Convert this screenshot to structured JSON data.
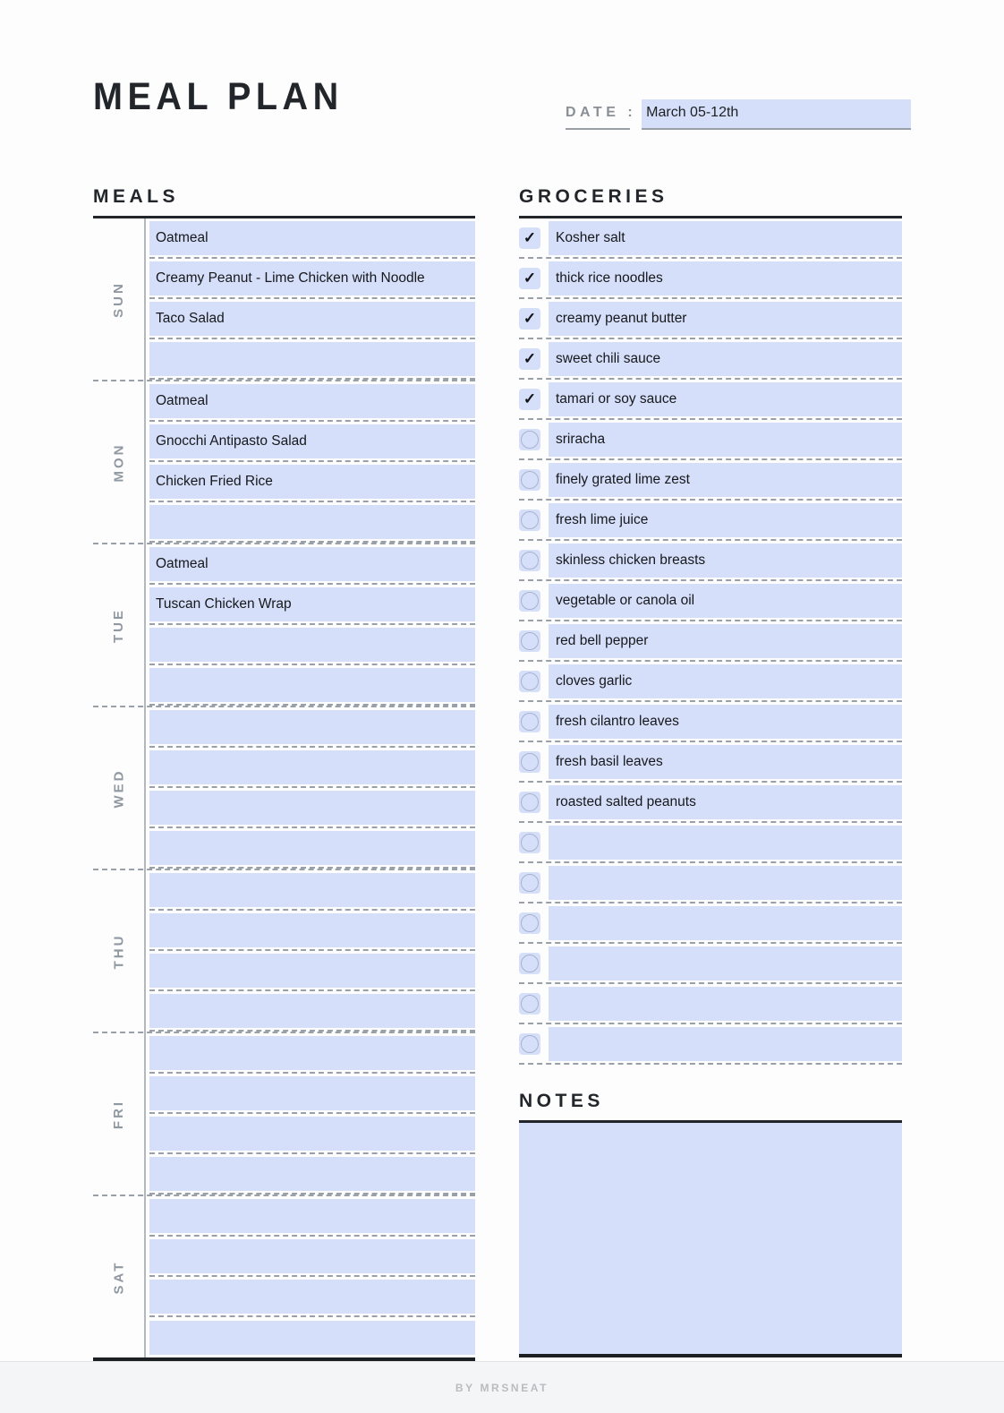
{
  "header": {
    "title": "MEAL PLAN",
    "date_label": "DATE :",
    "date_value": "March 05-12th"
  },
  "meals": {
    "heading": "MEALS",
    "days": [
      {
        "label": "SUN",
        "rows": [
          "Oatmeal",
          "Creamy Peanut - Lime Chicken with Noodle",
          "Taco Salad",
          ""
        ]
      },
      {
        "label": "MON",
        "rows": [
          "Oatmeal",
          "Gnocchi Antipasto Salad",
          "Chicken Fried Rice",
          ""
        ]
      },
      {
        "label": "TUE",
        "rows": [
          "Oatmeal",
          "Tuscan Chicken Wrap",
          "",
          ""
        ]
      },
      {
        "label": "WED",
        "rows": [
          "",
          "",
          "",
          ""
        ]
      },
      {
        "label": "THU",
        "rows": [
          "",
          "",
          "",
          ""
        ]
      },
      {
        "label": "FRI",
        "rows": [
          "",
          "",
          "",
          ""
        ]
      },
      {
        "label": "SAT",
        "rows": [
          "",
          "",
          "",
          ""
        ]
      }
    ]
  },
  "groceries": {
    "heading": "GROCERIES",
    "check_glyph": "✓",
    "items": [
      {
        "text": "Kosher salt",
        "checked": true
      },
      {
        "text": "thick rice noodles",
        "checked": true
      },
      {
        "text": "creamy peanut butter",
        "checked": true
      },
      {
        "text": "sweet chili sauce",
        "checked": true
      },
      {
        "text": "tamari or soy sauce",
        "checked": true
      },
      {
        "text": "sriracha",
        "checked": false
      },
      {
        "text": "finely grated lime zest",
        "checked": false
      },
      {
        "text": "fresh lime juice",
        "checked": false
      },
      {
        "text": "skinless chicken breasts",
        "checked": false
      },
      {
        "text": "vegetable or canola oil",
        "checked": false
      },
      {
        "text": "red bell pepper",
        "checked": false
      },
      {
        "text": "cloves garlic",
        "checked": false
      },
      {
        "text": "fresh cilantro leaves",
        "checked": false
      },
      {
        "text": "fresh basil leaves",
        "checked": false
      },
      {
        "text": "roasted salted peanuts",
        "checked": false
      },
      {
        "text": "",
        "checked": false
      },
      {
        "text": "",
        "checked": false
      },
      {
        "text": "",
        "checked": false
      },
      {
        "text": "",
        "checked": false
      },
      {
        "text": "",
        "checked": false
      },
      {
        "text": "",
        "checked": false
      }
    ]
  },
  "notes": {
    "heading": "NOTES",
    "value": ""
  },
  "footer": {
    "credit": "BY MRSNEAT"
  },
  "colors": {
    "field_blue": "#d6dffa",
    "ink": "#22262b",
    "muted": "#9098a2"
  }
}
